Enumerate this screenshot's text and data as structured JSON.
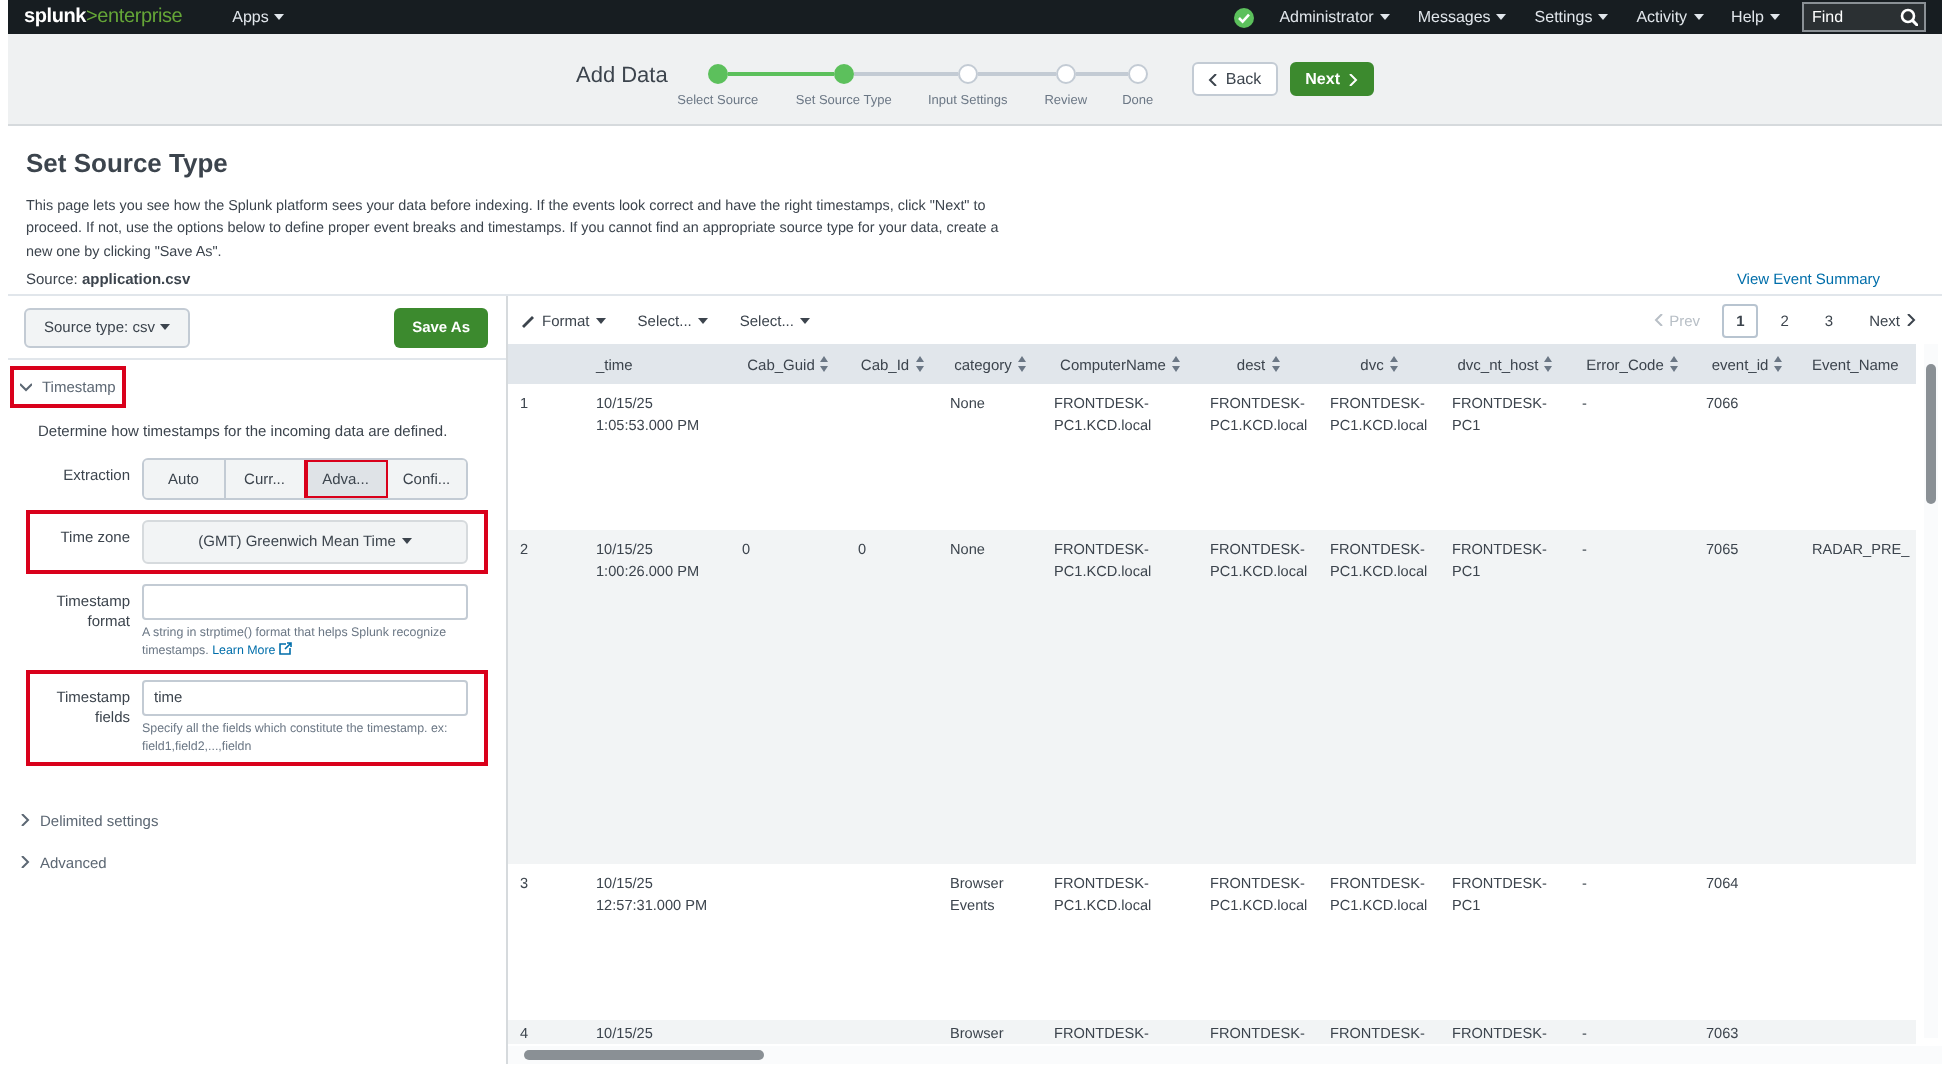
{
  "navbar": {
    "logo": {
      "brand": "splunk",
      "product": ">enterprise"
    },
    "menus": [
      {
        "label": "Apps",
        "kind": "menu"
      },
      {
        "label": "Administrator",
        "kind": "menu"
      },
      {
        "label": "Messages",
        "kind": "menu"
      },
      {
        "label": "Settings",
        "kind": "menu"
      },
      {
        "label": "Activity",
        "kind": "menu"
      },
      {
        "label": "Help",
        "kind": "menu"
      }
    ],
    "search": {
      "placeholder": "Find"
    }
  },
  "wizard": {
    "title": "Add Data",
    "steps": [
      {
        "label": "Select Source",
        "done": true
      },
      {
        "label": "Set Source Type",
        "done": true
      },
      {
        "label": "Input Settings",
        "done": false
      },
      {
        "label": "Review",
        "done": false
      },
      {
        "label": "Done",
        "done": false
      }
    ],
    "back": "Back",
    "next": "Next"
  },
  "page": {
    "title": "Set Source Type",
    "description": "This page lets you see how the Splunk platform sees your data before indexing. If the events look correct and have the right timestamps, click \"Next\" to proceed. If not, use the options below to define proper event breaks and timestamps. If you cannot find an appropriate source type for your data, create a new one by clicking \"Save As\".",
    "source": "Source: **application.csv**",
    "summary_link": "View Event Summary"
  },
  "left_panel": {
    "source_type": "Source type: csv",
    "save_as": "Save As",
    "sections": [
      {
        "label": "Timestamp",
        "expanded": true,
        "highlighted": true
      },
      {
        "label": "Delimited settings",
        "expanded": false,
        "highlighted": false
      },
      {
        "label": "Advanced",
        "expanded": false,
        "highlighted": false
      }
    ],
    "timestamp": {
      "intro": "Determine how timestamps for the incoming data are defined.",
      "extraction": {
        "label": "Extraction",
        "options": [
          {
            "label": "Auto",
            "selected": false,
            "highlighted": false
          },
          {
            "label": "Curr...",
            "selected": false,
            "highlighted": false
          },
          {
            "label": "Adva...",
            "selected": true,
            "highlighted": true
          },
          {
            "label": "Confi...",
            "selected": false,
            "highlighted": false
          }
        ]
      },
      "fields": [
        {
          "kind": "select",
          "label": "Time zone",
          "value": "(GMT) Greenwich Mean Time",
          "highlighted": true
        },
        {
          "kind": "text",
          "label": "Timestamp format",
          "help": "A string in strptime() format that helps Splunk recognize timestamps.",
          "link": "Learn More",
          "highlighted": false
        },
        {
          "kind": "text",
          "label": "Timestamp fields",
          "value": "time",
          "help": "Specify all the fields which constitute the timestamp. ex: field1,field2,...,fieldn",
          "highlighted": true
        }
      ]
    }
  },
  "toolbar": {
    "format": "Format",
    "selects": [
      "Select...",
      "Select..."
    ],
    "pagination": {
      "prev": "Prev",
      "prev_disabled": true,
      "pages": [
        {
          "label": "1",
          "selected": true
        },
        {
          "label": "2",
          "selected": false
        },
        {
          "label": "3",
          "selected": false
        }
      ],
      "next": "Next"
    }
  },
  "table": {
    "columns": [
      "_time",
      "Cab_Guid",
      "Cab_Id",
      "category",
      "ComputerName",
      "dest",
      "dvc",
      "dvc_nt_host",
      "Error_Code",
      "event_id",
      "Event_Name"
    ],
    "rows": [
      {
        "index": "1",
        "cells": [
          "10/15/25 1:05:53.000 PM",
          "",
          "",
          "None",
          "FRONTDESK-PC1.KCD.local",
          "FRONTDESK-PC1.KCD.local",
          "FRONTDESK-PC1.KCD.local",
          "FRONTDESK-PC1",
          "-",
          "7066",
          ""
        ]
      },
      {
        "index": "2",
        "cells": [
          "10/15/25 1:00:26.000 PM",
          "0",
          "0",
          "None",
          "FRONTDESK-PC1.KCD.local",
          "FRONTDESK-PC1.KCD.local",
          "FRONTDESK-PC1.KCD.local",
          "FRONTDESK-PC1",
          "-",
          "7065",
          "RADAR_PRE_"
        ]
      },
      {
        "index": "3",
        "cells": [
          "10/15/25 12:57:31.000 PM",
          "",
          "",
          "Browser Events",
          "FRONTDESK-PC1.KCD.local",
          "FRONTDESK-PC1.KCD.local",
          "FRONTDESK-PC1.KCD.local",
          "FRONTDESK-PC1",
          "-",
          "7064",
          ""
        ]
      },
      {
        "index": "4",
        "cells": [
          "10/15/25",
          "",
          "",
          "Browser",
          "FRONTDESK-",
          "FRONTDESK-",
          "FRONTDESK-",
          "FRONTDESK-",
          "-",
          "7063",
          ""
        ]
      }
    ]
  }
}
